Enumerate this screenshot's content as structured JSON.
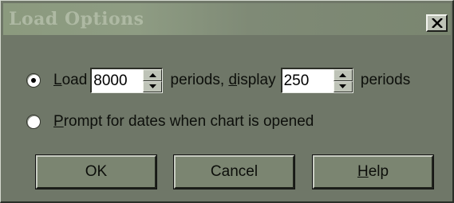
{
  "window": {
    "title": "Load Options",
    "close_icon": "close-x-icon"
  },
  "options": {
    "load": {
      "selected": true,
      "label_prefix": "Load",
      "load_value": "8000",
      "mid_text_a": " periods, ",
      "display_word": "display",
      "display_value": "250",
      "suffix": " periods"
    },
    "prompt": {
      "selected": false,
      "label": "Prompt for dates when chart is opened"
    }
  },
  "buttons": {
    "ok": "OK",
    "cancel": "Cancel",
    "help": "Help"
  },
  "colors": {
    "dialog_bg": "#6f7768",
    "button_face": "#7b8571",
    "input_bg": "#ffffff"
  }
}
